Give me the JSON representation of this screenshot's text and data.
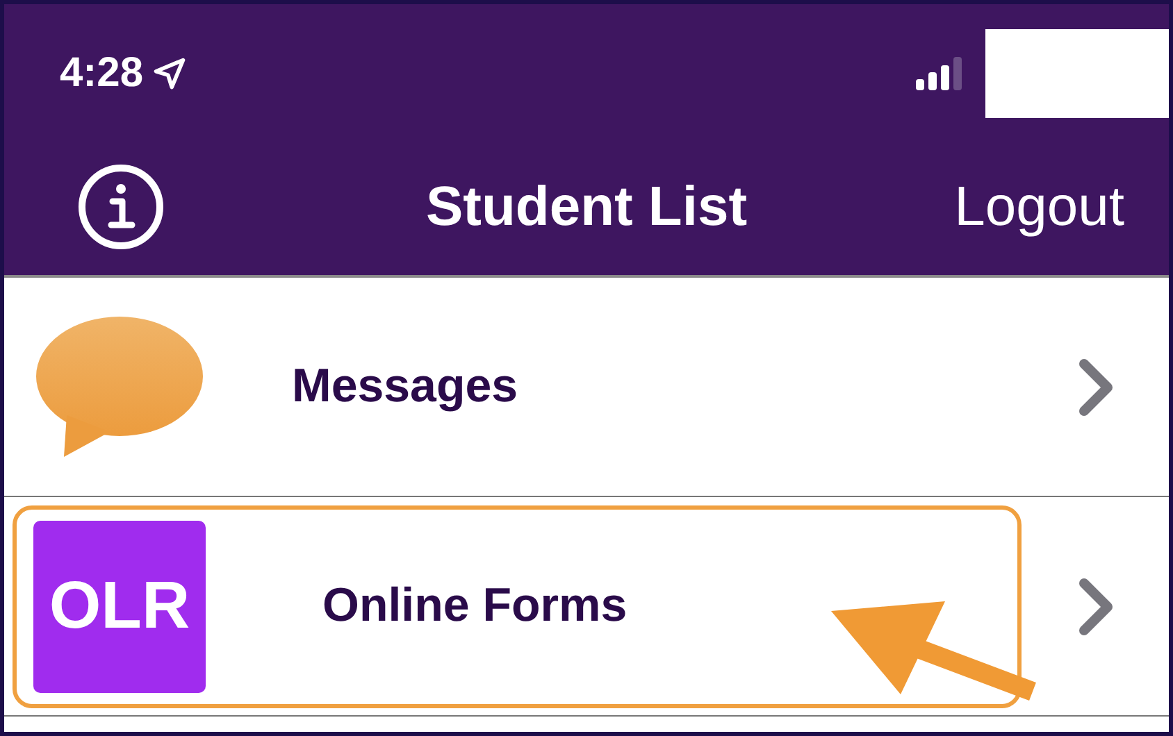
{
  "status_bar": {
    "time": "4:28"
  },
  "nav_bar": {
    "title": "Student List",
    "right_button": "Logout"
  },
  "items": [
    {
      "label": "Messages",
      "kind": "bubble",
      "highlighted": false
    },
    {
      "label": "Online Forms",
      "kind": "badge",
      "badge": "OLR",
      "highlighted": true
    }
  ]
}
